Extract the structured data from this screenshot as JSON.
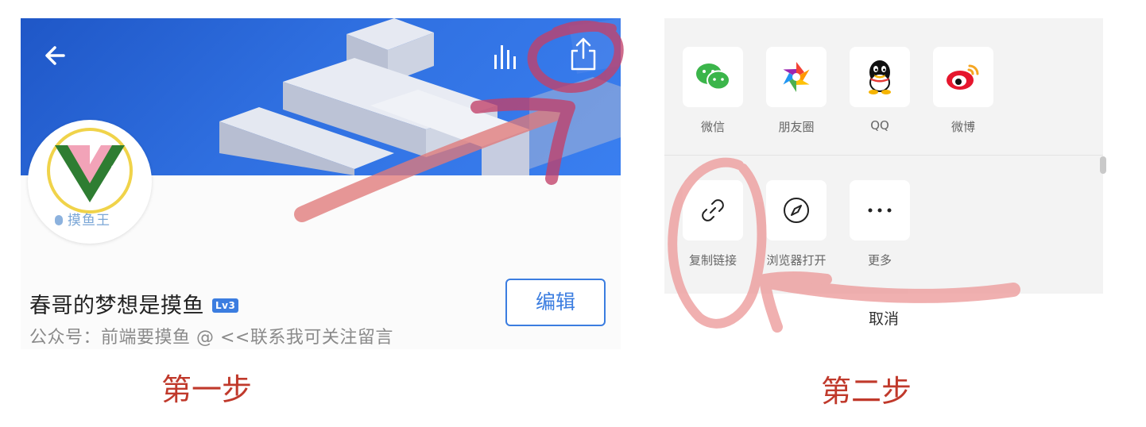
{
  "step1": {
    "caption": "第一步",
    "header": {
      "back_icon": "arrow-left-icon",
      "stats_icon": "bar-chart-icon",
      "share_icon": "share-upload-icon"
    },
    "avatar": {
      "tag_text": "摸鱼王",
      "colors": {
        "ring": "#f0d34a",
        "v_green": "#2e7d32",
        "v_pink": "#f2a3b8"
      }
    },
    "profile": {
      "name": "春哥的梦想是摸鱼",
      "level": "Lv3",
      "description": "公众号：前端要摸鱼 @ <<联系我可关注留言"
    },
    "edit_button": "编辑",
    "colors": {
      "accent": "#3b7de0",
      "banner": "#2f6fe0"
    }
  },
  "step2": {
    "caption": "第二步",
    "share_row": [
      {
        "label": "微信",
        "icon": "wechat-icon"
      },
      {
        "label": "朋友圈",
        "icon": "moments-icon"
      },
      {
        "label": "QQ",
        "icon": "qq-icon"
      },
      {
        "label": "微博",
        "icon": "weibo-icon"
      }
    ],
    "action_row": [
      {
        "label": "复制链接",
        "icon": "link-icon"
      },
      {
        "label": "浏览器打开",
        "icon": "compass-icon"
      },
      {
        "label": "更多",
        "icon": "more-dots-icon"
      }
    ],
    "cancel": "取消"
  },
  "annotation_color": "#e88c8c"
}
